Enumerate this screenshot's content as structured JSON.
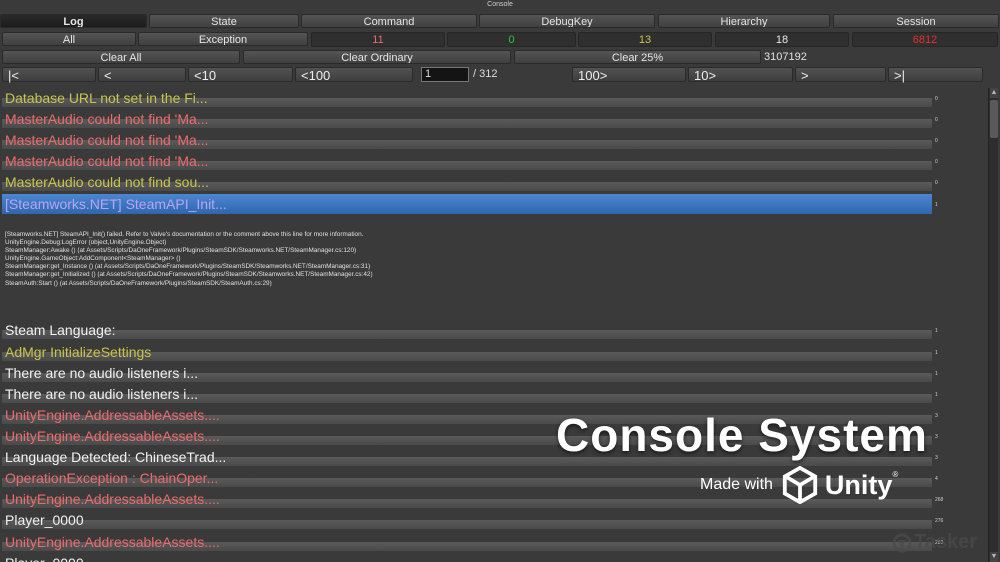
{
  "window": {
    "title": "Console"
  },
  "tabs": [
    {
      "label": "Log",
      "active": true
    },
    {
      "label": "State",
      "active": false
    },
    {
      "label": "Command",
      "active": false
    },
    {
      "label": "DebugKey",
      "active": false
    },
    {
      "label": "Hierarchy",
      "active": false
    },
    {
      "label": "Session",
      "active": false
    }
  ],
  "filters": {
    "all_label": "All",
    "exception_label": "Exception",
    "counts": [
      {
        "value": "11",
        "color": "#ef6a6a"
      },
      {
        "value": "0",
        "color": "#31c431"
      },
      {
        "value": "13",
        "color": "#c9c54a"
      },
      {
        "value": "18",
        "color": "#e8e8e8"
      },
      {
        "value": "6812",
        "color": "#e83030"
      }
    ]
  },
  "actions": {
    "clear_all": "Clear All",
    "clear_ordinary": "Clear Ordinary",
    "clear_25": "Clear 25%",
    "total": "3107192"
  },
  "pagination": {
    "first": "|<",
    "prev": "<",
    "prev10": "<10",
    "prev100": "<100",
    "current": "1",
    "total": "/ 312",
    "next100": "100>",
    "next10": "10>",
    "next": ">",
    "last": ">|"
  },
  "log_entries": [
    {
      "text": "Database URL not set in the Fi...",
      "color": "yellow",
      "count": "0"
    },
    {
      "text": "MasterAudio could not find 'Ma...",
      "color": "red",
      "count": "0"
    },
    {
      "text": "MasterAudio could not find 'Ma...",
      "color": "red",
      "count": "0"
    },
    {
      "text": "MasterAudio could not find 'Ma...",
      "color": "red",
      "count": "0"
    },
    {
      "text": "MasterAudio could not find sou...",
      "color": "yellow",
      "count": "0"
    },
    {
      "text": "[Steamworks.NET] SteamAPI_Init...",
      "color": "selected",
      "count": "1"
    },
    {
      "text": "Steam Language:",
      "color": "white",
      "count": "1"
    },
    {
      "text": "AdMgr InitializeSettings",
      "color": "yellow",
      "count": "1"
    },
    {
      "text": "There are no audio listeners i...",
      "color": "white",
      "count": "1"
    },
    {
      "text": "There are no audio listeners i...",
      "color": "white",
      "count": "1"
    },
    {
      "text": "UnityEngine.AddressableAssets....",
      "color": "red",
      "count": "3"
    },
    {
      "text": "UnityEngine.AddressableAssets....",
      "color": "red",
      "count": "3"
    },
    {
      "text": "Language Detected: ChineseTrad...",
      "color": "white",
      "count": "3"
    },
    {
      "text": "OperationException : ChainOper...",
      "color": "red",
      "count": "4"
    },
    {
      "text": "UnityEngine.AddressableAssets....",
      "color": "red",
      "count": "268"
    },
    {
      "text": "Player_0000",
      "color": "white",
      "count": "276"
    },
    {
      "text": "UnityEngine.AddressableAssets....",
      "color": "red",
      "count": "283"
    },
    {
      "text": "Player_0000",
      "color": "white",
      "count": ""
    }
  ],
  "stack_trace": [
    "[Steamworks.NET] SteamAPI_Init() failed. Refer to Valve's documentation or the comment above this line for more information.",
    "UnityEngine.Debug:LogError (object,UnityEngine.Object)",
    "SteamManager:Awake () (at Assets/Scripts/DaOneFramework/Plugins/SteamSDK/Steamworks.NET/SteamManager.cs:120)",
    "UnityEngine.GameObject:AddComponent<SteamManager> ()",
    "SteamManager:get_Instance () (at Assets/Scripts/DaOneFramework/Plugins/SteamSDK/Steamworks.NET/SteamManager.cs:31)",
    "SteamManager:get_Initialized () (at Assets/Scripts/DaOneFramework/Plugins/SteamSDK/Steamworks.NET/SteamManager.cs:42)",
    "SteamAuth:Start () (at Assets/Scripts/DaOneFramework/Plugins/SteamSDK/SteamAuth.cs:29)"
  ],
  "overlay": {
    "title": "Console System",
    "made_with": "Made with",
    "brand": "Unity",
    "brand_mark": "®",
    "watermark": "Tasker"
  }
}
